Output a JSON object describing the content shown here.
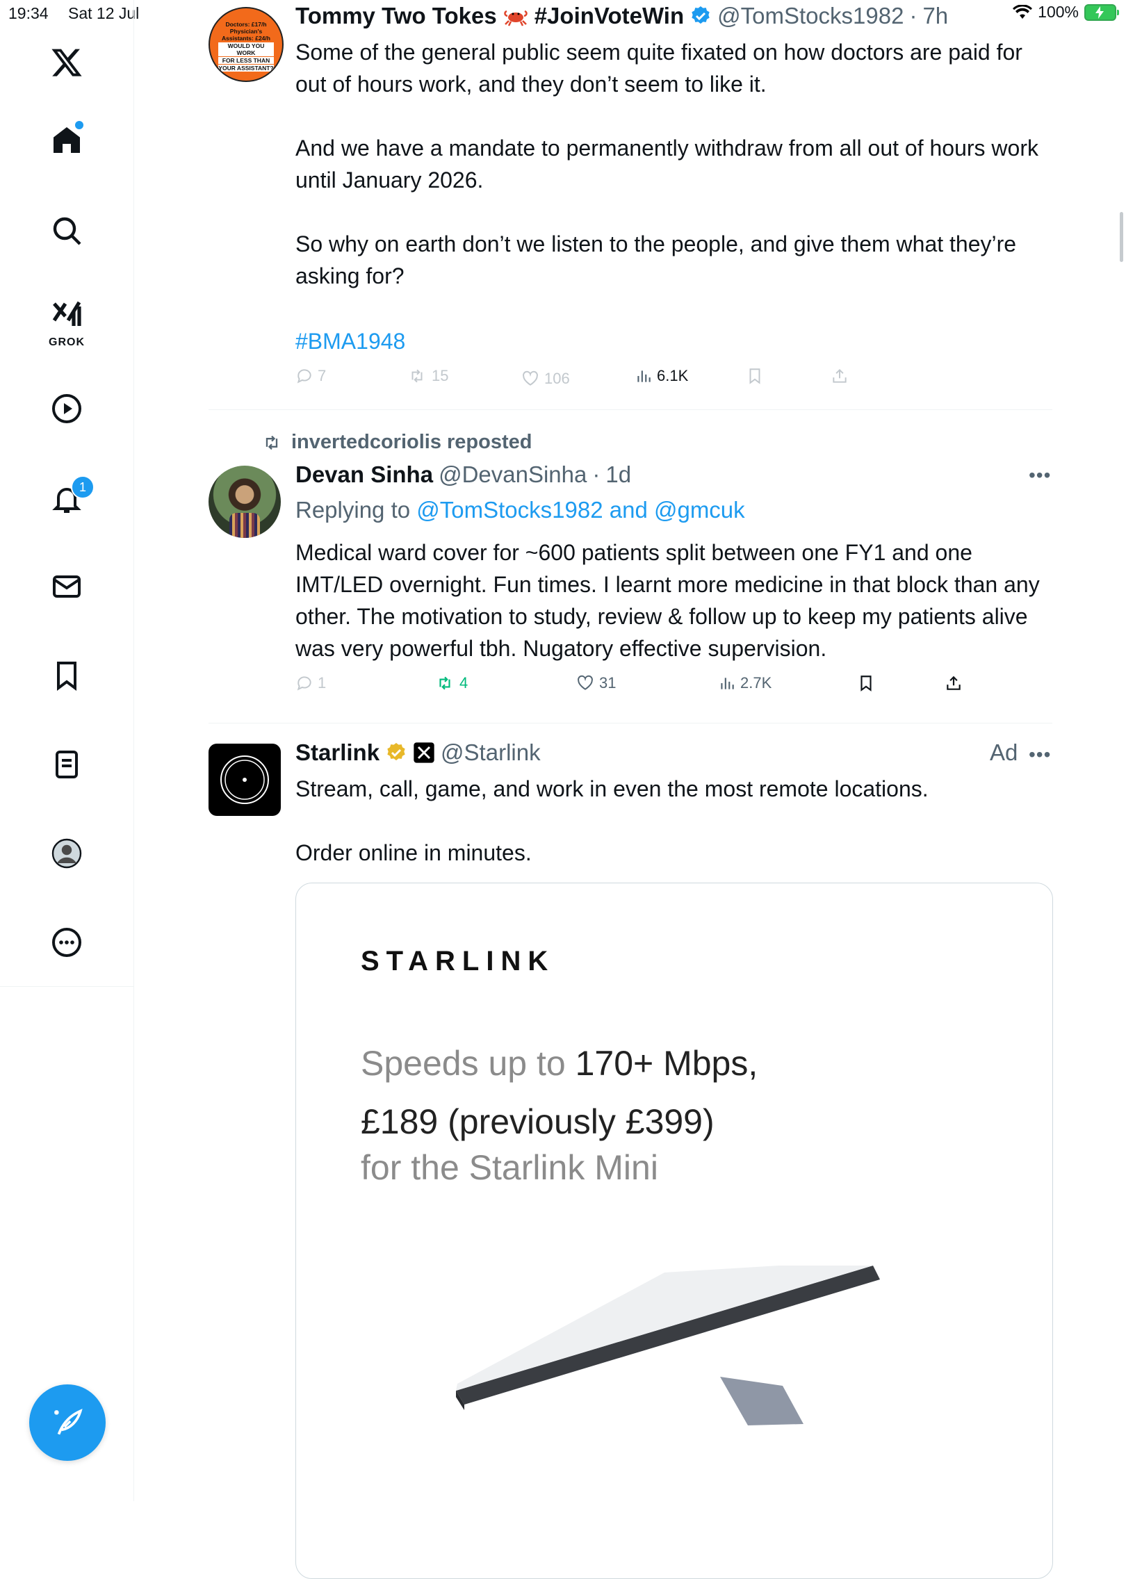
{
  "status_bar": {
    "time": "19:34",
    "date": "Sat 12 Jul",
    "battery": "100%"
  },
  "sidebar": {
    "items": [
      {
        "label": "Home"
      },
      {
        "label": "Search"
      },
      {
        "label": "GROK"
      },
      {
        "label": "Video"
      },
      {
        "label": "Notifications",
        "badge": "1"
      },
      {
        "label": "Messages"
      },
      {
        "label": "Bookmarks"
      },
      {
        "label": "Lists"
      },
      {
        "label": "Profile"
      },
      {
        "label": "More"
      }
    ],
    "compose_label": "Post"
  },
  "tweets": [
    {
      "name": "Tommy Two Tokes",
      "name_suffix": "#JoinVoteWin",
      "handle": "@TomStocks1982",
      "time": "7h",
      "avatar_text": [
        "Doctors: £17/h",
        "Physician's",
        "Assistants: £24/h",
        "WOULD YOU WORK",
        "FOR LESS THAN",
        "YOUR ASSISTANT?"
      ],
      "text": "Some of the general public seem quite fixated on how doctors are paid for out of hours work, and they don’t seem to like it.\n\nAnd we have a mandate to permanently withdraw from all out of hours work until January 2026.\n\nSo why on earth don’t we listen to the people, and give them what they’re asking for?",
      "hashtag": "#BMA1948",
      "stats": {
        "replies": "7",
        "reposts": "15",
        "likes": "106",
        "views": "6.1K"
      }
    },
    {
      "repost_by": "invertedcoriolis reposted",
      "name": "Devan Sinha",
      "handle": "@DevanSinha",
      "time": "1d",
      "replying_prefix": "Replying to",
      "replying_to": "@TomStocks1982 and @gmcuk",
      "text": "Medical ward cover for ~600 patients split between one FY1 and one IMT/LED overnight. Fun times. I learnt more medicine in that block than any other. The motivation to study, review & follow up to keep my patients alive was very powerful tbh. Nugatory effective supervision.",
      "stats": {
        "replies": "1",
        "reposts": "4",
        "likes": "31",
        "views": "2.7K"
      }
    },
    {
      "name": "Starlink",
      "handle": "@Starlink",
      "ad_label": "Ad",
      "text": "Stream, call, game, and work in even the most remote locations.\n\nOrder online in minutes.",
      "card": {
        "logo": "STARLINK",
        "line1_prefix": "Speeds up to ",
        "line1_value": "170+ Mbps,",
        "line2": "£189 (previously £399)",
        "line3": "for the Starlink Mini"
      }
    }
  ],
  "colors": {
    "accent": "#1d9bf0",
    "repost_green": "#00ba7c",
    "muted": "#536471",
    "verified_gold": "#e8b829"
  }
}
